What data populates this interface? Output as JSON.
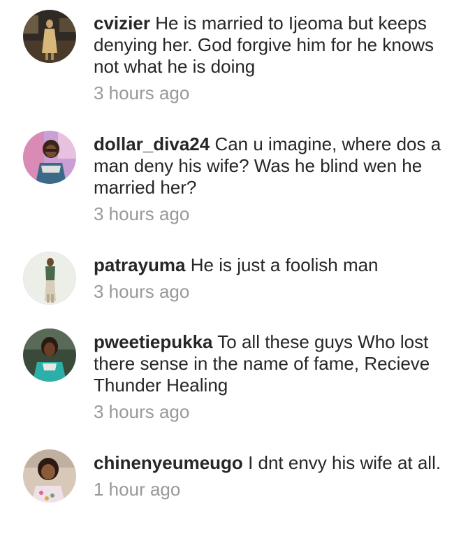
{
  "comments": [
    {
      "username": "cvizier",
      "text": "He is married to Ijeoma but keeps denying her. God forgive him for he knows not what he is doing",
      "time": "3 hours ago",
      "avatar": "user-photo"
    },
    {
      "username": "dollar_diva24",
      "text": "Can u imagine, where dos a man deny his wife? Was he blind wen he married her?",
      "time": "3 hours ago",
      "avatar": "user-photo"
    },
    {
      "username": "patrayuma",
      "text": "He is just a foolish man",
      "time": "3 hours ago",
      "avatar": "user-photo"
    },
    {
      "username": "pweetiepukka",
      "text": "To all these guys Who lost there sense in the name of fame, Recieve Thunder Healing",
      "time": "3 hours ago",
      "avatar": "user-photo"
    },
    {
      "username": "chinenyeumeugo",
      "text": "I dnt envy his wife at all.",
      "time": "1 hour ago",
      "avatar": "user-photo"
    }
  ],
  "colors": {
    "text": "#262626",
    "timestamp": "#999999",
    "background": "#ffffff"
  }
}
